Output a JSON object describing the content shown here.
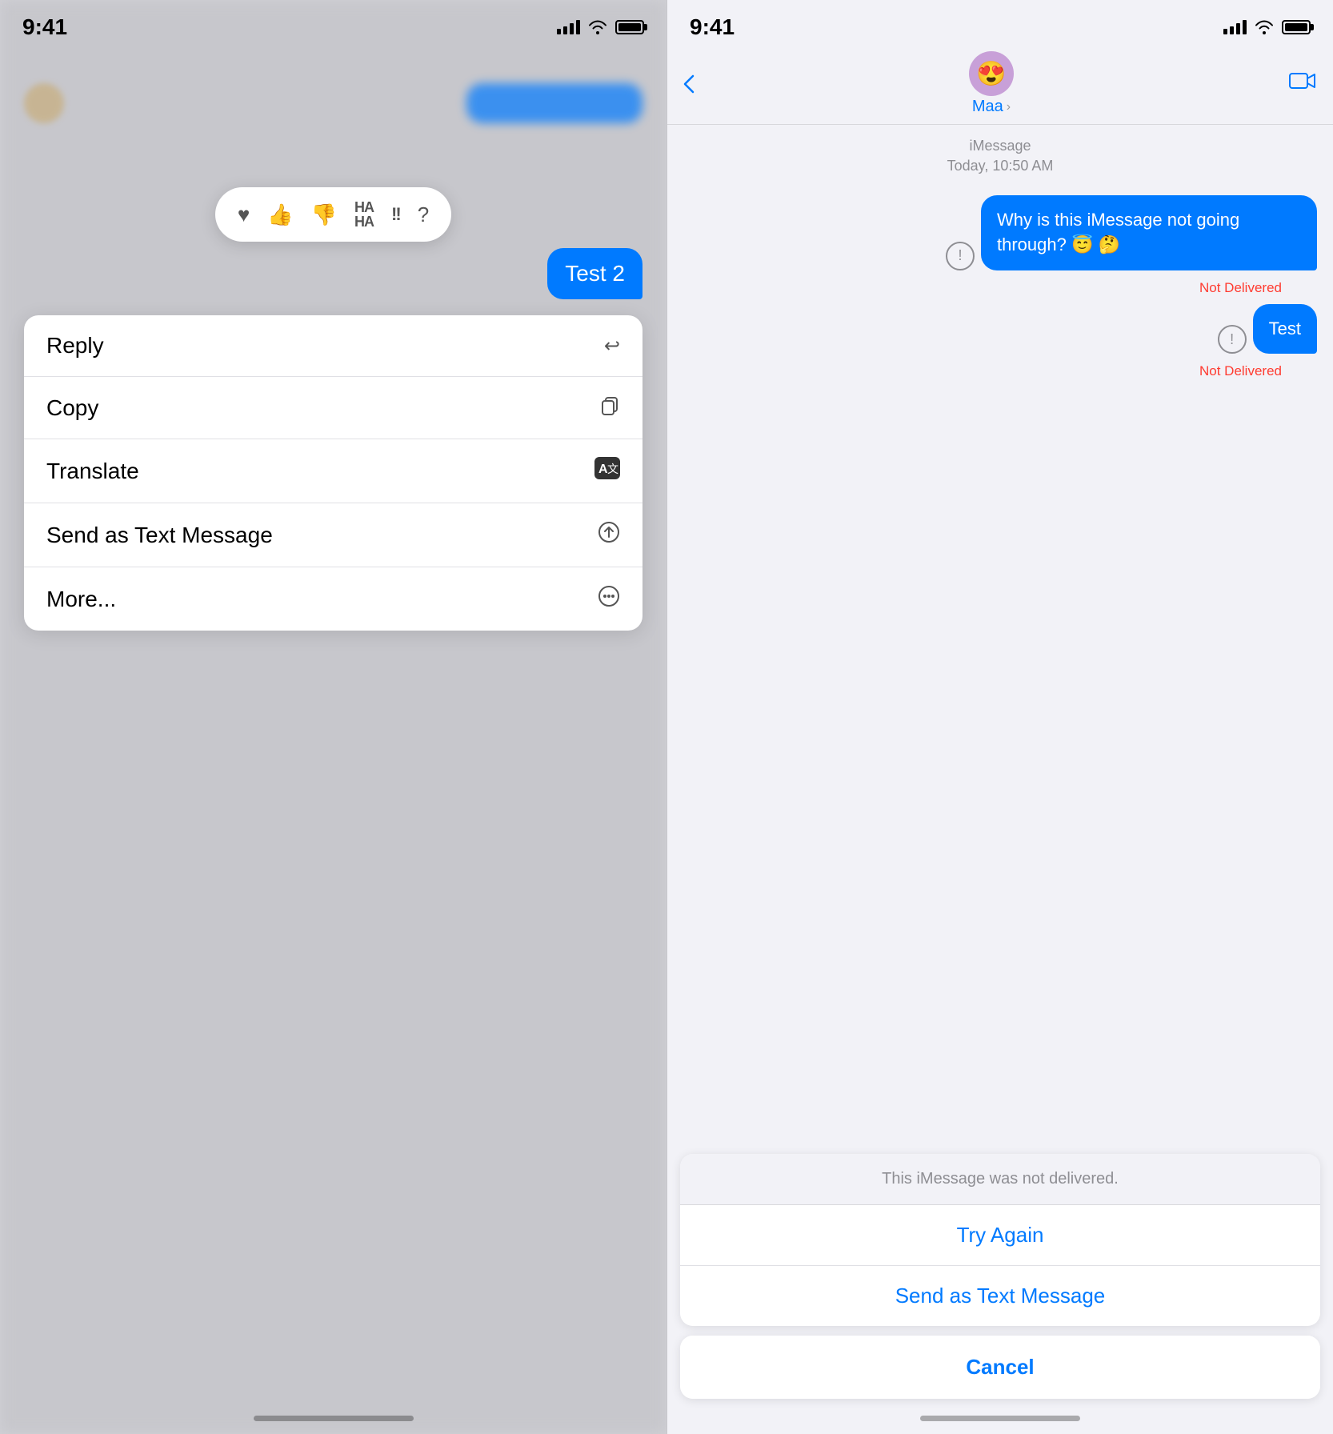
{
  "left": {
    "status_time": "9:41",
    "message_text": "Test 2",
    "reactions": [
      "❤️",
      "👍",
      "👎",
      "HAHA",
      "!!",
      "?"
    ],
    "menu_items": [
      {
        "label": "Reply",
        "icon": "↩"
      },
      {
        "label": "Copy",
        "icon": "⎘"
      },
      {
        "label": "Translate",
        "icon": "🈯"
      },
      {
        "label": "Send as Text Message",
        "icon": "⬆"
      },
      {
        "label": "More...",
        "icon": "⊕"
      }
    ]
  },
  "right": {
    "status_time": "9:41",
    "contact_name": "Maa",
    "imessage_label": "iMessage",
    "imessage_time": "Today, 10:50 AM",
    "messages": [
      {
        "text": "Why is this iMessage not going through? 😇 🤔",
        "status": "Not Delivered"
      },
      {
        "text": "Test",
        "status": "Not Delivered"
      }
    ],
    "action_sheet": {
      "info": "This iMessage was not delivered.",
      "try_again": "Try Again",
      "send_as_text": "Send as Text Message",
      "cancel": "Cancel"
    }
  }
}
